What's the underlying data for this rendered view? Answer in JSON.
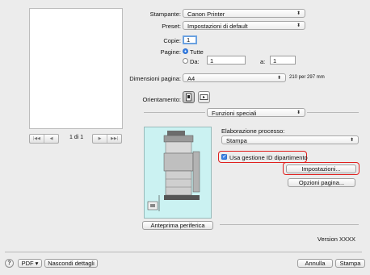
{
  "preview": {
    "page_indicator": "1 di 1",
    "nav_first": "|◀◀",
    "nav_prev": "◀",
    "nav_next": "▶",
    "nav_last": "▶▶|"
  },
  "printer": {
    "label": "Stampante:",
    "value": "Canon Printer"
  },
  "preset": {
    "label": "Preset:",
    "value": "Impostazioni di default"
  },
  "copies": {
    "label": "Copie:",
    "value": "1"
  },
  "pages": {
    "label": "Pagine:",
    "option_all": "Tutte",
    "option_from": "Da:",
    "from_value": "1",
    "to_label": "a:",
    "to_value": "1"
  },
  "paper_size": {
    "label": "Dimensioni pagina:",
    "value": "A4",
    "dimensions": "210 per 297 mm"
  },
  "orientation": {
    "label": "Orientamento:"
  },
  "section": {
    "value": "Funzioni speciali"
  },
  "processing": {
    "label": "Elaborazione processo:",
    "value": "Stampa"
  },
  "department_id": {
    "label": "Usa gestione ID dipartimento",
    "checked": true
  },
  "settings_button": "Impostazioni...",
  "page_options_button": "Opzioni pagina...",
  "device_preview_button": "Anteprima periferica",
  "version": "Version XXXX",
  "footer": {
    "help": "?",
    "pdf": "PDF",
    "hide_details": "Nascondi dettagli",
    "cancel": "Annulla",
    "print": "Stampa"
  },
  "colors": {
    "accent": "#3a82e6",
    "highlight": "#e0201e",
    "device_bg": "#cbf2f2"
  },
  "icons": [
    "printer-icon",
    "portrait-orientation-icon",
    "landscape-orientation-icon",
    "popup-arrows-icon",
    "checkmark-icon"
  ]
}
